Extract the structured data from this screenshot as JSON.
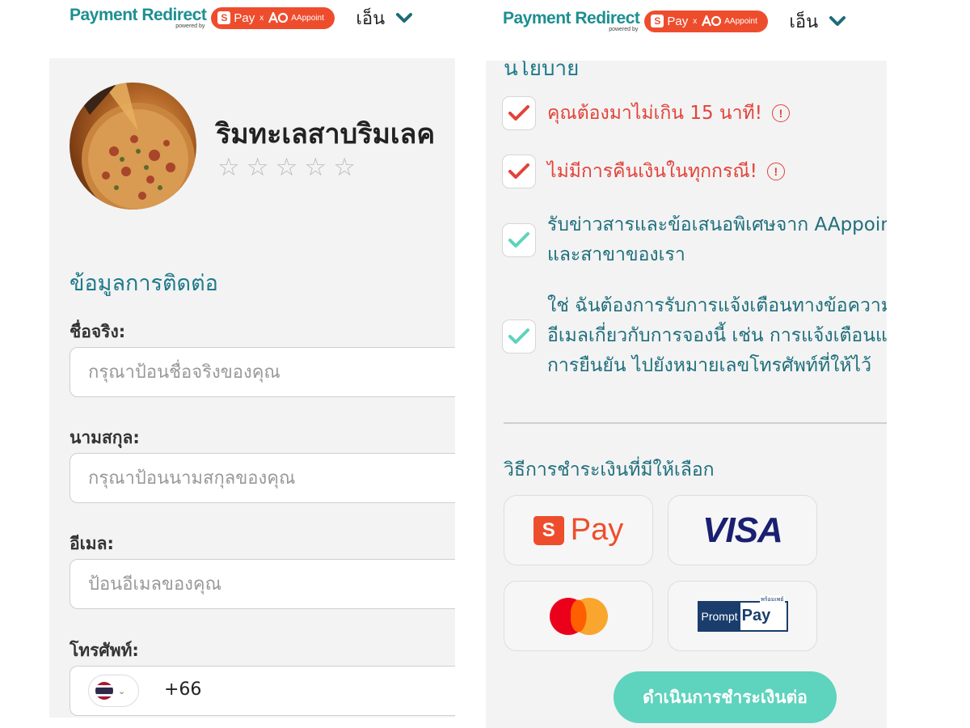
{
  "header": {
    "brand_title": "Payment Redirect",
    "brand_powered": "powered by",
    "partner_pay": "Pay",
    "partner_x": "x",
    "partner_aa": "AAppoint",
    "lang_label": "เอ็น"
  },
  "shop": {
    "name": "ริมทะเลสาบริมเลค",
    "stars": [
      "☆",
      "☆",
      "☆",
      "☆",
      "☆"
    ]
  },
  "contact": {
    "section_title": "ข้อมูลการติดต่อ",
    "first_name_label": "ชื่อจริง:",
    "first_name_placeholder": "กรุณาป้อนชื่อจริงของคุณ",
    "last_name_label": "นามสกุล:",
    "last_name_placeholder": "กรุณาป้อนนามสกุลของคุณ",
    "email_label": "อีเมล:",
    "email_placeholder": "ป้อนอีเมลของคุณ",
    "phone_label": "โทรศัพท์:",
    "dial_code": "+66"
  },
  "policy": {
    "heading_cut": "นโยบาย",
    "checkboxes": [
      {
        "lines": [
          "คุณต้องมาไม่เกิน 15 นาที!"
        ],
        "checked": true,
        "color": "#e2433a"
      },
      {
        "lines": [
          "ไม่มีการคืนเงินในทุกกรณี!"
        ],
        "checked": true,
        "color": "#e2433a"
      },
      {
        "lines": [
          "รับข่าวสารและข้อเสนอพิเศษจาก AAppoint",
          "และสาขาของเรา"
        ],
        "checked": true,
        "color": "#5ed3bd"
      },
      {
        "lines": [
          "ใช่ ฉันต้องการรับการแจ้งเตือนทางข้อความและ",
          "อีเมลเกี่ยวกับการจองนี้ เช่น การแจ้งเตือนและ",
          "การยืนยัน ไปยังหมายเลขโทรศัพท์ที่ให้ไว้"
        ],
        "checked": true,
        "color": "#5ed3bd"
      }
    ],
    "info_icon": "!"
  },
  "payment": {
    "title": "วิธีการชำระเงินที่มีให้เลือก",
    "spay_letter": "S",
    "spay_text": "Pay",
    "visa_text": "VISA",
    "promptpay_prompt": "Prompt",
    "promptpay_pay": "Pay",
    "promptpay_thai": "พร้อมเพย์",
    "continue_label": "ดำเนินการชำระเงินต่อ"
  },
  "colors": {
    "brand_teal": "#1d8f91",
    "shopee_orange": "#ee4d2d",
    "warning_red": "#e2433a",
    "check_teal": "#5ed3bd",
    "button_teal": "#5ed3bd",
    "visa_blue": "#1a1f71"
  }
}
